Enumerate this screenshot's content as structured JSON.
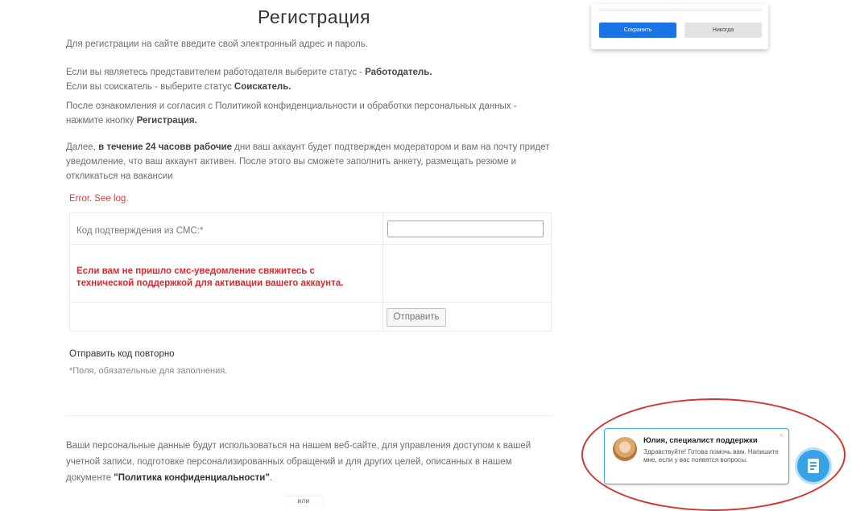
{
  "page": {
    "title": "Регистрация",
    "intro": "Для регистрации на сайте введите свой электронный адрес и пароль.",
    "employer_text": "Если вы являетесь представителем работодателя выберите статус - ",
    "employer_status": "Работодатель.",
    "seeker_text": "Если вы соискатель - выберите статус ",
    "seeker_status": "Соискатель.",
    "policy_text": "После ознакомления и согласия с Политикой конфиденциальности и обработки персональных данных - нажмите кнопку ",
    "policy_button_name": "Регистрация.",
    "moderation_prefix": "Далее, ",
    "moderation_bold": "в течение 24 часовв рабочие",
    "moderation_text": " дни ваш аккаунт будет подтвержден модератором и вам на почту придет уведомление, что ваш аккаунт активен. После этого вы сможете заполнить анкету, размещать резюме и откликаться на вакансии",
    "error": "Error. See log."
  },
  "form": {
    "code_label": "Код подтверждения из СМС:*",
    "code_value": "",
    "warning": "Если вам не пришло смс-уведомление свяжитесь с технической поддержкой для активации вашего аккаунта.",
    "submit_label": "Отправить",
    "resend_label": "Отправить код повторно",
    "required_note": "*Поля, обязательные для заполнения."
  },
  "privacy": {
    "text": "Ваши персональные данные будут использоваться на нашем веб-сайте, для управления доступом к вашей учетной записи, подготовке персонализированных обращений и для других целей, описанных в нашем документе ",
    "link": "\"Политика конфиденциальности\"",
    "end": "."
  },
  "separator_label": "или",
  "save_popup": {
    "save_label": "Сохранить",
    "never_label": "Никогда"
  },
  "chat": {
    "agent_name": "Юлия, специалист поддержки",
    "message": "Здравствуйте! Готова помочь вам. Напишите мне, если у вас появятся вопросы.",
    "close": "×"
  },
  "colors": {
    "accent": "#37a3e6",
    "error": "#e0262e",
    "highlight": "#d9312b"
  },
  "icons": [
    "avatar",
    "close-icon",
    "chat-icon"
  ]
}
